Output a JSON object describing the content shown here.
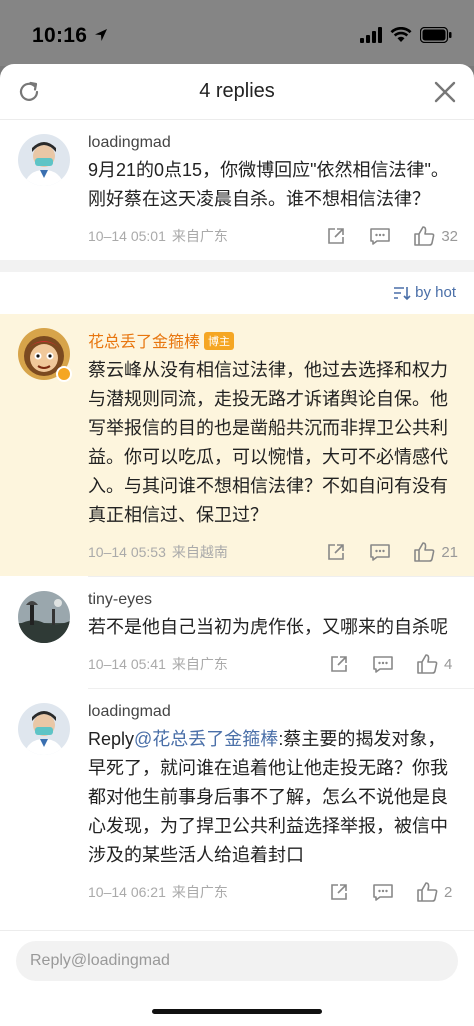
{
  "status_bar": {
    "time": "10:16"
  },
  "header": {
    "title": "4 replies"
  },
  "main_comment": {
    "username": "loadingmad",
    "text": "9月21的0点15，你微博回应\"依然相信法律\"。刚好蔡在这天凌晨自杀。谁不想相信法律？",
    "time": "10–14 05:01",
    "location": "来自广东",
    "likes": "32"
  },
  "sort": {
    "label": "by hot"
  },
  "replies": [
    {
      "username": "花总丢了金箍棒",
      "badge": "博主",
      "text": "蔡云峰从没有相信过法律，他过去选择和权力与潜规则同流，走投无路才诉诸舆论自保。他写举报信的目的也是凿船共沉而非捍卫公共利益。你可以吃瓜，可以惋惜，大可不必情感代入。与其问谁不想相信法律？不如自问有没有真正相信过、保卫过？",
      "time": "10–14 05:53",
      "location": "来自越南",
      "likes": "21"
    },
    {
      "username": "tiny-eyes",
      "text": "若不是他自己当初为虎作伥，又哪来的自杀呢",
      "time": "10–14 05:41",
      "location": "来自广东",
      "likes": "4"
    },
    {
      "username": "loadingmad",
      "reply_prefix": "Reply",
      "mention": "@花总丢了金箍棒",
      "text": ":蔡主要的揭发对象，早死了，就问谁在追着他让他走投无路？你我都对他生前事身后事不了解，怎么不说他是良心发现，为了捍卫公共利益选择举报，被信中涉及的某些活人给追着封口",
      "time": "10–14 06:21",
      "location": "来自广东",
      "likes": "2"
    }
  ],
  "reply_box": {
    "placeholder": "Reply@loadingmad"
  },
  "colors": {
    "accent_blue": "#4a6fa8",
    "blogger_orange": "#e8760f",
    "highlight_bg": "#fdf5dd"
  }
}
